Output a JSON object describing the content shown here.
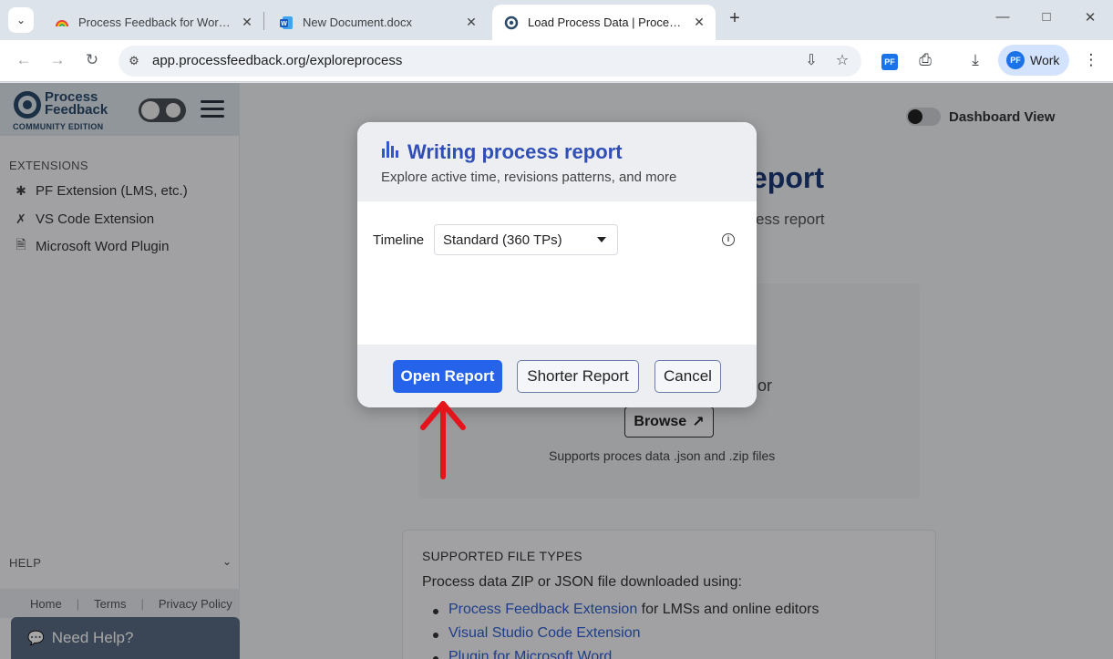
{
  "browser": {
    "tabs": [
      {
        "title": "Process Feedback for Word Onl",
        "favicon": "rainbow-icon",
        "active": false
      },
      {
        "title": "New Document.docx",
        "favicon": "word-icon",
        "active": false
      },
      {
        "title": "Load Process Data | Process Fee",
        "favicon": "process-feedback-icon",
        "active": true
      }
    ],
    "url": "app.processfeedback.org/exploreprocess",
    "extension_badge": "PF",
    "profile_label": "Work"
  },
  "sidebar": {
    "logo_line1": "Process",
    "logo_line2": "Feedback",
    "logo_sub": "COMMUNITY EDITION",
    "extensions_heading": "EXTENSIONS",
    "items": [
      {
        "label": "PF Extension (LMS, etc.)",
        "icon": "puzzle-icon"
      },
      {
        "label": "VS Code Extension",
        "icon": "vscode-icon"
      },
      {
        "label": "Microsoft Word Plugin",
        "icon": "word-doc-icon"
      }
    ],
    "help_heading": "HELP",
    "footer_links": [
      "Home",
      "Terms",
      "Privacy Policy"
    ],
    "need_help": "Need Help?"
  },
  "main": {
    "dashboard_view_label": "Dashboard View",
    "bg_title_fragment": "eport",
    "bg_subtitle_fragment": "ess report",
    "dropzone_or": "or",
    "browse_label": "Browse",
    "supports_text": "Supports proces data .json and .zip files",
    "filetypes": {
      "title": "SUPPORTED FILE TYPES",
      "desc": "Process data ZIP or JSON file downloaded using:",
      "items": [
        {
          "link": "Process Feedback Extension",
          "rest": " for LMSs and online editors"
        },
        {
          "link": "Visual Studio Code Extension",
          "rest": ""
        },
        {
          "link": "Plugin for Microsoft Word",
          "rest": ""
        }
      ]
    }
  },
  "modal": {
    "title": "Writing process report",
    "subtitle": "Explore active time, revisions patterns, and more",
    "timeline_label": "Timeline",
    "timeline_value": "Standard (360 TPs)",
    "buttons": {
      "primary": "Open Report",
      "secondary": "Shorter Report",
      "cancel": "Cancel"
    }
  },
  "colors": {
    "accent": "#2563eb",
    "title": "#2f4fb5",
    "annotation_arrow": "#e5141c"
  }
}
